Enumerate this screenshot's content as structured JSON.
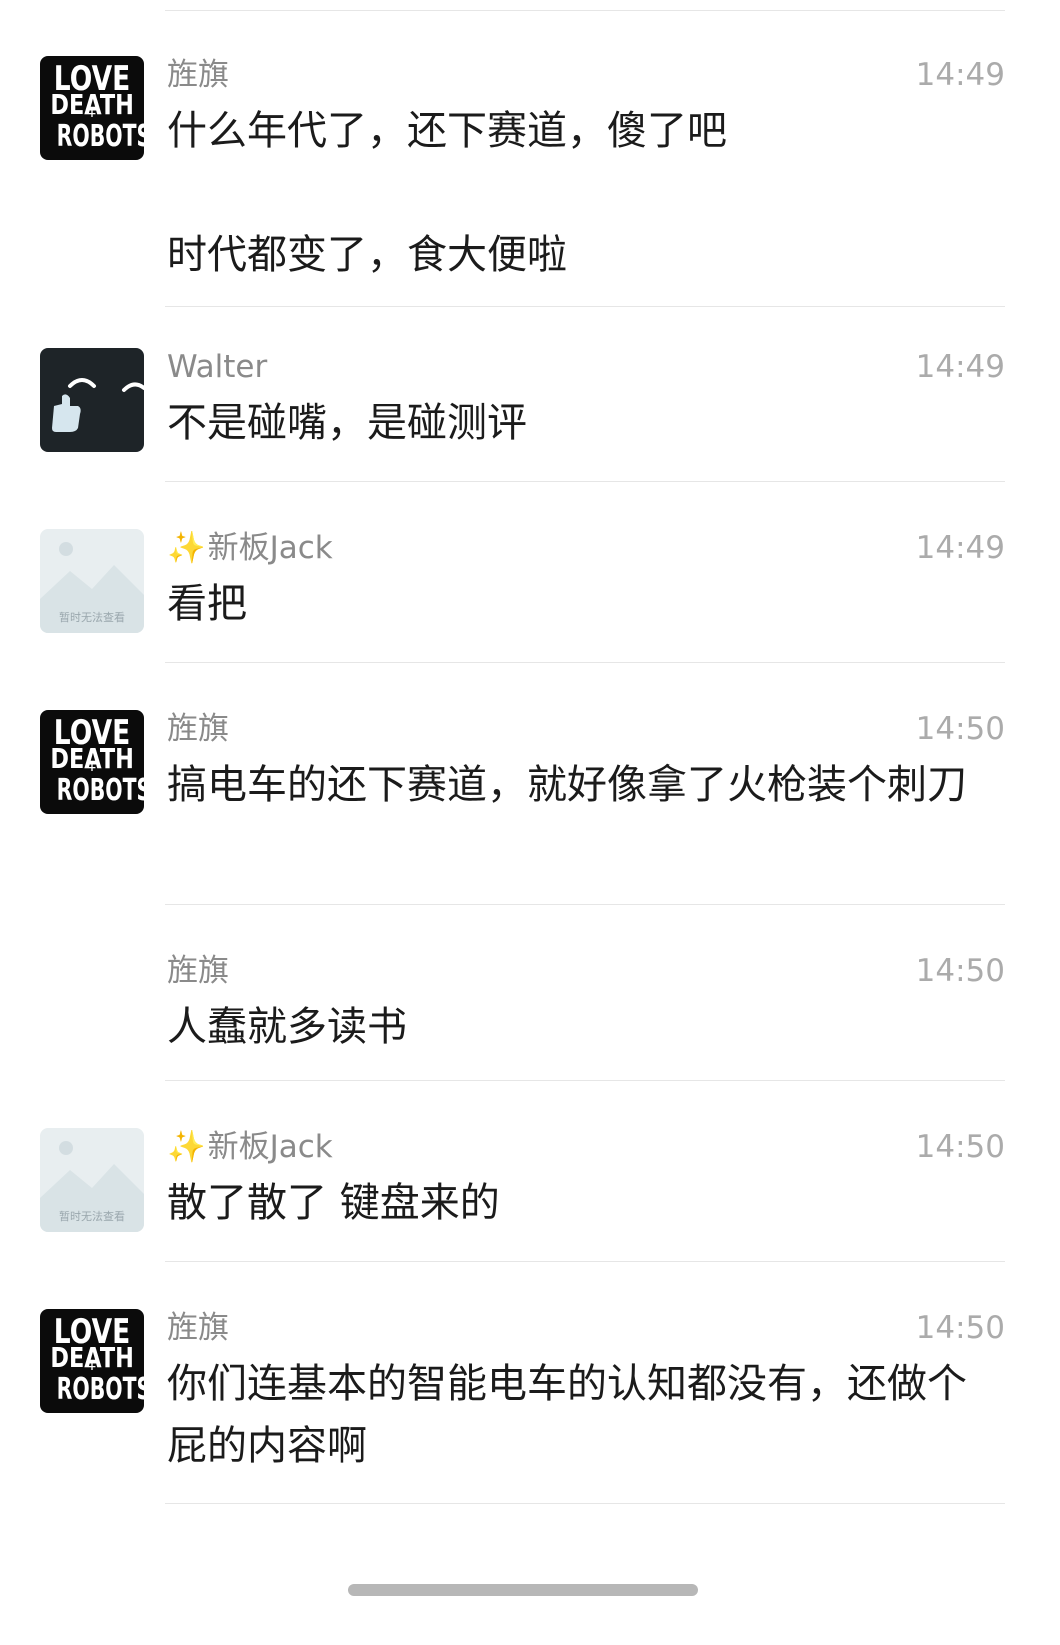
{
  "messages": [
    {
      "sender": "旌旗",
      "time": "14:49",
      "text": "什么年代了，还下赛道，傻了吧\n\n时代都变了，食大便啦",
      "avatar": "love-death-robots"
    },
    {
      "sender": "Walter",
      "time": "14:49",
      "text": "不是碰嘴，是碰测评",
      "avatar": "walter-face"
    },
    {
      "sender": "新板Jack",
      "sender_prefix": "✨",
      "time": "14:49",
      "text": "看把",
      "avatar": "image-unavailable",
      "avatar_caption": "暂时无法查看"
    },
    {
      "sender": "旌旗",
      "time": "14:50",
      "text": "搞电车的还下赛道，就好像拿了火枪装个刺刀",
      "avatar": "love-death-robots"
    },
    {
      "sender": "旌旗",
      "time": "14:50",
      "text": "人蠢就多读书",
      "avatar": "none"
    },
    {
      "sender": "新板Jack",
      "sender_prefix": "✨",
      "time": "14:50",
      "text": "散了散了 键盘来的",
      "avatar": "image-unavailable",
      "avatar_caption": "暂时无法查看"
    },
    {
      "sender": "旌旗",
      "time": "14:50",
      "text": "你们连基本的智能电车的认知都没有，还做个屁的内容啊",
      "avatar": "love-death-robots"
    }
  ],
  "avatar_text": {
    "love": "LOVE",
    "death": "DEATH",
    "plus": "+",
    "robots": "ROBOTS"
  },
  "colors": {
    "background": "#ffffff",
    "sender": "#8a8a8a",
    "time": "#ababab",
    "text": "#1b1b1b",
    "divider": "#e6e6e6"
  }
}
